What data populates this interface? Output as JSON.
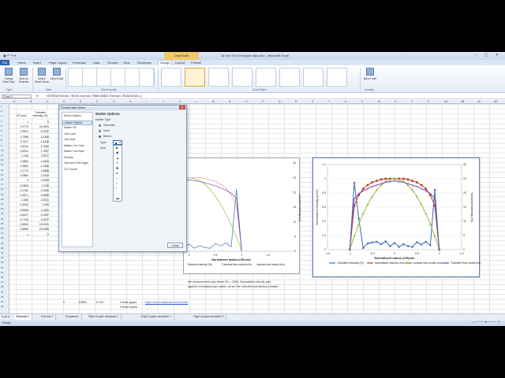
{
  "window": {
    "title": "14 nov 2014 Example data.xlsx - Microsoft Excel",
    "context_tab": "Chart Tools",
    "controls": "– ▢ ✕"
  },
  "ribbon": {
    "tabs": [
      "File",
      "Home",
      "Insert",
      "Page Layout",
      "Formulas",
      "Data",
      "Review",
      "View",
      "Developer",
      "Design",
      "Layout",
      "Format"
    ],
    "buttons": {
      "change_chart_type": "Change Chart Type",
      "save_as_template": "Save As Template",
      "switch_row_column": "Switch Row/Column",
      "select_data": "Select Data",
      "move_chart": "Move Chart"
    },
    "groups": [
      "Type",
      "Data",
      "Chart Layouts",
      "Chart Styles",
      "Location"
    ]
  },
  "formula_bar": {
    "name_box": "Chart 2",
    "fx": "fx",
    "formula": "=SERIES('Exercise 1'!$C$3,'Exercise 1'!$B$4:$B$24,'Exercise 1'!$C$4:$C$24,1)"
  },
  "columns": [
    "A",
    "B",
    "C",
    "D",
    "E",
    "F",
    "G",
    "H",
    "I",
    "J",
    "K",
    "L",
    "M",
    "N",
    "O",
    "P",
    "Q",
    "R",
    "S",
    "T",
    "U",
    "V",
    "W",
    "X",
    "Y",
    "Z",
    "AA",
    "AB",
    "AC",
    "AD"
  ],
  "rows": [
    "1",
    "2",
    "3",
    "4",
    "5",
    "6",
    "7",
    "8",
    "9",
    "10",
    "11",
    "12",
    "13",
    "14",
    "15",
    "16",
    "17",
    "18",
    "19",
    "20",
    "21",
    "22",
    "23",
    "24",
    "25",
    "26",
    "27",
    "28",
    "29",
    "30",
    "31",
    "32",
    "33",
    "34",
    "35",
    "36",
    "37",
    "38",
    "39",
    "40",
    "41",
    "42"
  ],
  "table": {
    "header_b": "r/R (mm)",
    "header_c": "Turbulent intensity (%)",
    "col_b": [
      "1",
      "0.9770",
      "0.9004",
      "0.7956",
      "0.7007",
      "0.6210",
      "0.5323",
      "0.448",
      "0.3551",
      "0.2662",
      "0.1773",
      "0.0884",
      "0",
      "-0.0893",
      "-0.1782",
      "-0.2671",
      "-0.356",
      "-0.4449",
      "-0.5338",
      "-0.6227",
      "-0.7116",
      "-0.8004",
      "-0.8893",
      "-1"
    ],
    "col_c": [
      "0",
      "21.0901",
      "5.0302",
      "3.2268",
      "1.5318",
      "2.7694",
      "1.7897",
      "2.5917",
      "1.0431",
      "1.2356",
      "1.8868",
      "1.0318",
      "2.4383",
      "0.245",
      "2.9425",
      "0.8656",
      "2.8231",
      "2.454",
      "2.1811",
      "0.1087",
      "0.0022",
      "10.9131",
      "23.6158",
      "0"
    ],
    "row28": {
      "a": "0",
      "b": "0.0802",
      "c": "0.7117"
    }
  },
  "notes": {
    "line1": "the measurement pipe where Re = 3454. Normalized velocity, and",
    "line2": "against normalized pipe radius, as are the turbulent and laminar models.",
    "create_graph_label": "Create graph:",
    "create_graph_link": "https://www.wikipedia.com/en/wiki",
    "format_series_label": "Format series:"
  },
  "dialog": {
    "title": "Format Data Series",
    "close": "✕",
    "list": [
      "Series Options",
      "Marker Options",
      "Marker Fill",
      "Line Color",
      "Line Style",
      "Marker Line Color",
      "Marker Line Style",
      "Shadow",
      "Glow and Soft Edges",
      "3-D Format"
    ],
    "selected_index": 1,
    "section_title": "Marker Options",
    "subsection": "Marker Type",
    "options": [
      "Automatic",
      "None",
      "Built-in"
    ],
    "selected_option": 2,
    "type_label": "Type:",
    "size_label": "Size:",
    "marker_symbols": [
      "■",
      "◆",
      "▲",
      "✕",
      "✱",
      "●",
      "—",
      "+",
      "▪",
      "▫",
      "▬"
    ],
    "close_button": "Close"
  },
  "chart_left": {
    "xlabel": "Normalized radius (r/R) mm",
    "yaxis_right_label": "Turbulent intensity (%)",
    "x_ticks": [
      "-0.5",
      "0",
      "0.5",
      "1",
      "1.5"
    ],
    "y_ticks": [
      "0",
      "5",
      "10",
      "15",
      "20",
      "25",
      "30"
    ],
    "legend": [
      "Turbulent intensity (%)",
      "Turbulent flow model (m/s)",
      "Laminar flow model (m/s)"
    ]
  },
  "chart_data": {
    "type": "line",
    "xlabel": "Normalized radius (r/R)mm",
    "ylabel": "Normalized velocity (U/Uc)",
    "y2label": "Turbulent intensity (%)",
    "xlim": [
      -1.5,
      1.5
    ],
    "ylim": [
      0,
      1.2
    ],
    "y2lim": [
      0,
      30
    ],
    "x_ticks": [
      "-1.5",
      "-1",
      "-0.5",
      "0",
      "0.5",
      "1",
      "1.5"
    ],
    "y_ticks": [
      "0",
      "0.2",
      "0.4",
      "0.6",
      "0.8",
      "1",
      "1.2"
    ],
    "y2_ticks": [
      "0",
      "5",
      "10",
      "15",
      "20",
      "25",
      "30"
    ],
    "x": [
      -1,
      -0.9,
      -0.8,
      -0.7,
      -0.6,
      -0.5,
      -0.4,
      -0.3,
      -0.2,
      -0.1,
      0,
      0.1,
      0.2,
      0.3,
      0.4,
      0.5,
      0.6,
      0.7,
      0.8,
      0.9,
      1
    ],
    "series": [
      {
        "name": "Turbulent intensity (%)",
        "axis": "y2",
        "color": "#3b6cb3",
        "values": [
          0,
          23.6,
          10.9,
          0.5,
          2.2,
          2.5,
          2.8,
          1.9,
          2.9,
          1.2,
          2.4,
          1.0,
          1.9,
          1.2,
          1.0,
          2.6,
          1.8,
          2.8,
          1.5,
          21.1,
          0
        ]
      },
      {
        "name": "Normalized velocity U/Uc (m/s)",
        "axis": "y",
        "color": "#c0392b",
        "values": [
          0,
          0.62,
          0.77,
          0.86,
          0.91,
          0.95,
          0.97,
          0.99,
          1.0,
          1.0,
          1.0,
          1.0,
          1.0,
          0.99,
          0.97,
          0.95,
          0.91,
          0.86,
          0.77,
          0.62,
          0
        ]
      },
      {
        "name": "Laminar flow model (m/s)",
        "axis": "y",
        "color": "#8fbf3f",
        "values": [
          0,
          0.19,
          0.36,
          0.51,
          0.64,
          0.75,
          0.84,
          0.91,
          0.96,
          0.99,
          1.0,
          0.99,
          0.96,
          0.91,
          0.84,
          0.75,
          0.64,
          0.51,
          0.36,
          0.19,
          0
        ]
      },
      {
        "name": "Turbulent flow model (m/s)",
        "axis": "y",
        "color": "#7a4aa8",
        "values": [
          0,
          0.72,
          0.79,
          0.83,
          0.86,
          0.89,
          0.91,
          0.93,
          0.95,
          0.96,
          0.97,
          0.96,
          0.95,
          0.93,
          0.91,
          0.89,
          0.86,
          0.83,
          0.79,
          0.72,
          0
        ]
      }
    ]
  },
  "sheet_tabs": [
    "Exercise 1",
    "Exercise 2",
    "Programme",
    "Flight of paper aeroplane 1",
    "Flight of paper aeroplane 2",
    "Flight of paper aeroplane 3"
  ],
  "active_sheet": 0,
  "status": "Ready"
}
